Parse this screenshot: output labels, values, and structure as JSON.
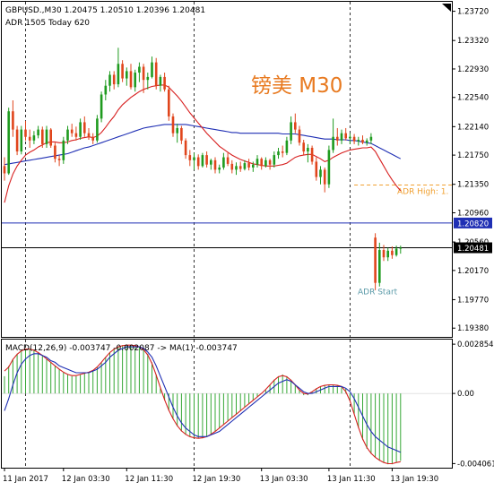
{
  "chart_data": {
    "type": "candlestick",
    "symbol_header": "GBPUSD.,M30  1.20475 1.20510 1.20396 1.20481",
    "adr_line": "ADR 1505  Today 620",
    "watermark": "镑美 M30",
    "colors": {
      "bull": "#1f9b1f",
      "bear": "#e0451c",
      "ma_fast": "#d71f1f",
      "ma_slow": "#1f2fb4",
      "adr_high": "#f0a030",
      "adr_start": "#5a9aa8",
      "macd_hist": "#36a836",
      "macd_line": "#1f2fb4",
      "signal_line": "#d71f1f",
      "hline_blue": "#1f2fb4",
      "watermark": "#e87a20"
    },
    "price_axis": {
      "range": [
        1.1926,
        1.2385
      ],
      "ticks": [
        "1.23720",
        "1.23320",
        "1.22930",
        "1.22540",
        "1.22140",
        "1.21750",
        "1.21350",
        "1.20960",
        "1.20560",
        "1.20170",
        "1.19770",
        "1.19380"
      ],
      "tick_values": [
        1.2372,
        1.2332,
        1.2293,
        1.2254,
        1.2214,
        1.2175,
        1.2135,
        1.2096,
        1.2056,
        1.2017,
        1.1977,
        1.1938
      ]
    },
    "horizontal_lines": [
      {
        "label": "1.20820",
        "value": 1.2082,
        "color": "#1f2fb4"
      },
      {
        "label": "1.20481",
        "value": 1.20481,
        "color": "#000000"
      }
    ],
    "annotations": [
      {
        "text": "ADR High: 1.",
        "value": 1.2134
      },
      {
        "text": "ADR Start",
        "value": 1.1977
      }
    ],
    "candles": [
      [
        1.216,
        1.2172,
        1.214,
        1.215
      ],
      [
        1.215,
        1.224,
        1.2148,
        1.2235
      ],
      [
        1.2235,
        1.225,
        1.22,
        1.221
      ],
      [
        1.221,
        1.2215,
        1.2175,
        1.218
      ],
      [
        1.218,
        1.2215,
        1.2176,
        1.221
      ],
      [
        1.221,
        1.2222,
        1.2195,
        1.22
      ],
      [
        1.22,
        1.221,
        1.2185,
        1.2195
      ],
      [
        1.2195,
        1.2208,
        1.219,
        1.2202
      ],
      [
        1.2202,
        1.2215,
        1.2198,
        1.221
      ],
      [
        1.221,
        1.2214,
        1.2185,
        1.219
      ],
      [
        1.219,
        1.2215,
        1.2185,
        1.221
      ],
      [
        1.221,
        1.2212,
        1.2185,
        1.2188
      ],
      [
        1.2188,
        1.2192,
        1.2165,
        1.217
      ],
      [
        1.217,
        1.2175,
        1.216,
        1.2168
      ],
      [
        1.2168,
        1.22,
        1.2163,
        1.2195
      ],
      [
        1.2195,
        1.2215,
        1.219,
        1.221
      ],
      [
        1.221,
        1.2218,
        1.22,
        1.2205
      ],
      [
        1.2205,
        1.2214,
        1.2195,
        1.22
      ],
      [
        1.22,
        1.2225,
        1.2196,
        1.222
      ],
      [
        1.222,
        1.2228,
        1.22,
        1.2205
      ],
      [
        1.2205,
        1.2212,
        1.2196,
        1.22
      ],
      [
        1.22,
        1.2205,
        1.219,
        1.2195
      ],
      [
        1.2195,
        1.223,
        1.2192,
        1.2225
      ],
      [
        1.2225,
        1.2262,
        1.222,
        1.2258
      ],
      [
        1.2258,
        1.2278,
        1.225,
        1.227
      ],
      [
        1.227,
        1.229,
        1.2262,
        1.2285
      ],
      [
        1.2285,
        1.229,
        1.2265,
        1.2272
      ],
      [
        1.2272,
        1.2322,
        1.2268,
        1.23
      ],
      [
        1.23,
        1.2305,
        1.2275,
        1.228
      ],
      [
        1.228,
        1.2295,
        1.227,
        1.229
      ],
      [
        1.229,
        1.23,
        1.2265,
        1.2268
      ],
      [
        1.2268,
        1.2292,
        1.2262,
        1.2288
      ],
      [
        1.2288,
        1.2302,
        1.2275,
        1.2296
      ],
      [
        1.2296,
        1.23,
        1.226,
        1.2278
      ],
      [
        1.2278,
        1.2288,
        1.2265,
        1.2282
      ],
      [
        1.2282,
        1.231,
        1.228,
        1.2302
      ],
      [
        1.2302,
        1.2308,
        1.2265,
        1.227
      ],
      [
        1.227,
        1.2285,
        1.2262,
        1.2282
      ],
      [
        1.2282,
        1.2288,
        1.2262,
        1.2265
      ],
      [
        1.2265,
        1.227,
        1.2222,
        1.2228
      ],
      [
        1.2228,
        1.2232,
        1.22,
        1.2205
      ],
      [
        1.2205,
        1.2218,
        1.2192,
        1.2212
      ],
      [
        1.2212,
        1.2215,
        1.219,
        1.2195
      ],
      [
        1.2195,
        1.2198,
        1.217,
        1.2175
      ],
      [
        1.2175,
        1.2182,
        1.216,
        1.2168
      ],
      [
        1.2168,
        1.2178,
        1.2155,
        1.2172
      ],
      [
        1.2172,
        1.2176,
        1.2155,
        1.216
      ],
      [
        1.216,
        1.2178,
        1.2158,
        1.2175
      ],
      [
        1.2175,
        1.218,
        1.2158,
        1.2162
      ],
      [
        1.2162,
        1.217,
        1.2155,
        1.2168
      ],
      [
        1.2168,
        1.2172,
        1.215,
        1.2155
      ],
      [
        1.2155,
        1.2162,
        1.215,
        1.2158
      ],
      [
        1.2158,
        1.2178,
        1.2155,
        1.2172
      ],
      [
        1.2172,
        1.2178,
        1.216,
        1.2163
      ],
      [
        1.2163,
        1.2168,
        1.215,
        1.2155
      ],
      [
        1.2155,
        1.2165,
        1.2148,
        1.216
      ],
      [
        1.216,
        1.2166,
        1.2152,
        1.2156
      ],
      [
        1.2156,
        1.2168,
        1.2154,
        1.2164
      ],
      [
        1.2164,
        1.217,
        1.2154,
        1.2158
      ],
      [
        1.2158,
        1.2166,
        1.2152,
        1.2162
      ],
      [
        1.2162,
        1.2175,
        1.2158,
        1.217
      ],
      [
        1.217,
        1.2172,
        1.2155,
        1.216
      ],
      [
        1.216,
        1.2172,
        1.2158,
        1.2168
      ],
      [
        1.2168,
        1.217,
        1.2155,
        1.2162
      ],
      [
        1.2162,
        1.218,
        1.2158,
        1.2175
      ],
      [
        1.2175,
        1.2185,
        1.217,
        1.218
      ],
      [
        1.218,
        1.2188,
        1.2172,
        1.2178
      ],
      [
        1.2178,
        1.22,
        1.2175,
        1.2195
      ],
      [
        1.2195,
        1.2228,
        1.219,
        1.222
      ],
      [
        1.222,
        1.2232,
        1.2205,
        1.221
      ],
      [
        1.221,
        1.2215,
        1.2188,
        1.2192
      ],
      [
        1.2192,
        1.2196,
        1.2175,
        1.218
      ],
      [
        1.218,
        1.219,
        1.2165,
        1.2185
      ],
      [
        1.2185,
        1.2188,
        1.2162,
        1.2166
      ],
      [
        1.2166,
        1.2172,
        1.214,
        1.2145
      ],
      [
        1.2145,
        1.216,
        1.2135,
        1.2155
      ],
      [
        1.2155,
        1.2158,
        1.2124,
        1.2135
      ],
      [
        1.2135,
        1.2188,
        1.213,
        1.2182
      ],
      [
        1.2182,
        1.2225,
        1.2178,
        1.22
      ],
      [
        1.22,
        1.2212,
        1.2188,
        1.2195
      ],
      [
        1.2195,
        1.221,
        1.219,
        1.2205
      ],
      [
        1.2205,
        1.2212,
        1.2195,
        1.2198
      ],
      [
        1.2198,
        1.2205,
        1.219,
        1.22
      ],
      [
        1.22,
        1.2204,
        1.219,
        1.2194
      ],
      [
        1.2194,
        1.22,
        1.2188,
        1.2196
      ],
      [
        1.2196,
        1.2202,
        1.219,
        1.2192
      ],
      [
        1.2192,
        1.2198,
        1.2188,
        1.2195
      ],
      [
        1.2195,
        1.2205,
        1.219,
        1.22
      ],
      [
        1.2062,
        1.2068,
        1.199,
        1.2
      ],
      [
        1.2,
        1.2055,
        1.1995,
        1.2045
      ],
      [
        1.2045,
        1.2052,
        1.203,
        1.2035
      ],
      [
        1.2035,
        1.2048,
        1.203,
        1.2044
      ],
      [
        1.2044,
        1.205,
        1.2033,
        1.2038
      ],
      [
        1.2038,
        1.2051,
        1.2036,
        1.2047
      ],
      [
        1.2047,
        1.2051,
        1.204,
        1.2048
      ]
    ],
    "ma_fast": [
      1.211,
      1.2133,
      1.2149,
      1.216,
      1.2168,
      1.2175,
      1.2179,
      1.2182,
      1.2186,
      1.2189,
      1.2192,
      1.2193,
      1.2193,
      1.2192,
      1.2192,
      1.2193,
      1.2195,
      1.2196,
      1.2198,
      1.2199,
      1.22,
      1.2199,
      1.2201,
      1.2206,
      1.2213,
      1.2221,
      1.2228,
      1.2237,
      1.2244,
      1.2249,
      1.2254,
      1.2258,
      1.2262,
      1.2265,
      1.2267,
      1.2269,
      1.227,
      1.2271,
      1.2271,
      1.2268,
      1.2262,
      1.2256,
      1.2249,
      1.2241,
      1.2233,
      1.2226,
      1.2219,
      1.2212,
      1.2205,
      1.2199,
      1.2193,
      1.2187,
      1.2183,
      1.2179,
      1.2175,
      1.2172,
      1.2169,
      1.2167,
      1.2165,
      1.2163,
      1.2162,
      1.2161,
      1.216,
      1.216,
      1.216,
      1.2161,
      1.2162,
      1.2164,
      1.2168,
      1.2172,
      1.2174,
      1.2175,
      1.2176,
      1.2176,
      1.2173,
      1.217,
      1.2166,
      1.2168,
      1.2172,
      1.2175,
      1.2178,
      1.218,
      1.2182,
      1.2183,
      1.2184,
      1.2185,
      1.2185,
      1.2186,
      1.218,
      1.217,
      1.216,
      1.215,
      1.2141,
      1.2133,
      1.2126
    ],
    "ma_slow": [
      1.2162,
      1.2163,
      1.2164,
      1.2165,
      1.2166,
      1.2167,
      1.2168,
      1.2169,
      1.217,
      1.2171,
      1.2172,
      1.2173,
      1.2174,
      1.2175,
      1.2176,
      1.2177,
      1.2179,
      1.2181,
      1.2183,
      1.2185,
      1.2186,
      1.2188,
      1.219,
      1.2192,
      1.2194,
      1.2196,
      1.2198,
      1.22,
      1.2202,
      1.2204,
      1.2206,
      1.2208,
      1.221,
      1.2212,
      1.2213,
      1.2214,
      1.2215,
      1.2216,
      1.2217,
      1.2217,
      1.2217,
      1.2217,
      1.2217,
      1.2217,
      1.2216,
      1.2215,
      1.2214,
      1.2213,
      1.2212,
      1.2211,
      1.221,
      1.2209,
      1.2208,
      1.2207,
      1.2206,
      1.2206,
      1.2205,
      1.2205,
      1.2205,
      1.2205,
      1.2205,
      1.2205,
      1.2205,
      1.2205,
      1.2205,
      1.2205,
      1.2204,
      1.2204,
      1.2204,
      1.2204,
      1.2203,
      1.2202,
      1.2201,
      1.22,
      1.2199,
      1.2198,
      1.2197,
      1.2197,
      1.2197,
      1.2196,
      1.2196,
      1.2196,
      1.2195,
      1.2195,
      1.2194,
      1.2193,
      1.2192,
      1.2191,
      1.2188,
      1.2185,
      1.2182,
      1.2179,
      1.2176,
      1.2173,
      1.217
    ],
    "macd_panel": {
      "label": "MACD(12,26,9) -0.003747 -0.002087 -> MA(1) -0.003747",
      "range": [
        -0.0043,
        0.00312
      ],
      "ticks": [
        "0.002854",
        "0.00",
        "-0.004061"
      ],
      "tick_values": [
        0.002854,
        0.0,
        -0.004061
      ],
      "histogram": [
        0.001,
        0.0016,
        0.002,
        0.0023,
        0.0025,
        0.0026,
        0.0026,
        0.0025,
        0.0024,
        0.0022,
        0.002,
        0.0018,
        0.0016,
        0.0014,
        0.0012,
        0.0011,
        0.001,
        0.001,
        0.0011,
        0.0012,
        0.0012,
        0.0013,
        0.0015,
        0.0018,
        0.0021,
        0.0024,
        0.0026,
        0.0027,
        0.0028,
        0.0028,
        0.0028,
        0.0028,
        0.0027,
        0.0026,
        0.0023,
        0.0018,
        0.0011,
        0.0003,
        -0.0004,
        -0.001,
        -0.0015,
        -0.0019,
        -0.0022,
        -0.0024,
        -0.0025,
        -0.0026,
        -0.0026,
        -0.0026,
        -0.0025,
        -0.0024,
        -0.0022,
        -0.002,
        -0.0018,
        -0.0016,
        -0.0014,
        -0.0012,
        -0.001,
        -0.0008,
        -0.0006,
        -0.0004,
        -0.0002,
        0.0,
        0.0002,
        0.0005,
        0.0008,
        0.001,
        0.0011,
        0.001,
        0.0008,
        0.0005,
        0.0002,
        -0.0001,
        -0.0001,
        0.0001,
        0.0003,
        0.0004,
        0.0005,
        0.0005,
        0.0005,
        0.0005,
        0.0004,
        0.0003,
        -0.0004,
        -0.0012,
        -0.002,
        -0.0027,
        -0.0032,
        -0.0035,
        -0.0037,
        -0.0039,
        -0.004,
        -0.0041,
        -0.0041,
        -0.004,
        -0.0039
      ],
      "signal": [
        -0.001,
        -0.0003,
        0.0005,
        0.0012,
        0.0017,
        0.002,
        0.0022,
        0.0023,
        0.0023,
        0.0022,
        0.0021,
        0.0019,
        0.0018,
        0.0016,
        0.0015,
        0.0014,
        0.0013,
        0.0012,
        0.0012,
        0.0012,
        0.0012,
        0.0013,
        0.0014,
        0.0016,
        0.0018,
        0.0021,
        0.0023,
        0.0025,
        0.0026,
        0.0027,
        0.0027,
        0.0027,
        0.0027,
        0.0026,
        0.0024,
        0.0021,
        0.0016,
        0.001,
        0.0004,
        -0.0002,
        -0.0008,
        -0.0013,
        -0.0017,
        -0.002,
        -0.0022,
        -0.0024,
        -0.0025,
        -0.0025,
        -0.0025,
        -0.0024,
        -0.0023,
        -0.0022,
        -0.002,
        -0.0018,
        -0.0016,
        -0.0014,
        -0.0012,
        -0.001,
        -0.0008,
        -0.0006,
        -0.0004,
        -0.0002,
        0.0,
        0.0002,
        0.0004,
        0.0006,
        0.0007,
        0.0008,
        0.0007,
        0.0005,
        0.0003,
        0.0001,
        0.0,
        0.0,
        0.0001,
        0.0002,
        0.0003,
        0.0004,
        0.0004,
        0.0004,
        0.0004,
        0.0003,
        0.0001,
        -0.0003,
        -0.0008,
        -0.0013,
        -0.0018,
        -0.0022,
        -0.0025,
        -0.0027,
        -0.0029,
        -0.0031,
        -0.0032,
        -0.0033,
        -0.0034
      ]
    },
    "x_axis": {
      "labels": [
        "11 Jan 2017",
        "12 Jan 03:30",
        "12 Jan 11:30",
        "12 Jan 19:30",
        "13 Jan 03:30",
        "13 Jan 11:30",
        "13 Jan 19:30"
      ],
      "label_candle_index": [
        0,
        14,
        29,
        45,
        61,
        77,
        92
      ]
    },
    "vertical_dashed_lines_at_candle": [
      5,
      45,
      82
    ]
  }
}
